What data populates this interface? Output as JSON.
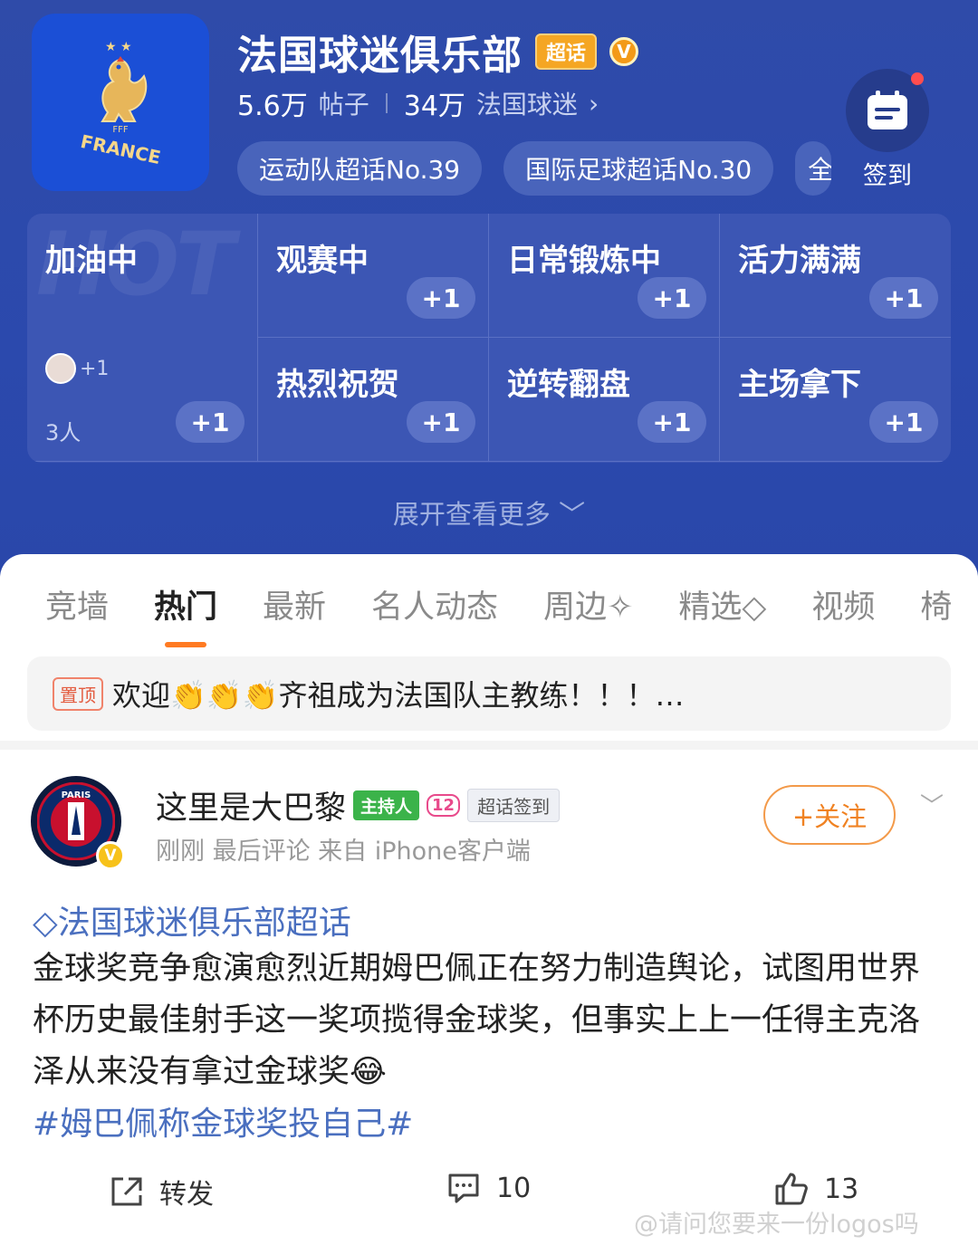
{
  "header": {
    "logo_text": "FRANCE",
    "title": "法国球迷俱乐部",
    "chaohua_badge": "超话",
    "verified_badge": "V",
    "posts_count": "5.6万",
    "posts_label": "帖子",
    "fans_count": "34万",
    "fans_label": "法国球迷",
    "tags": [
      "运动队超话No.39",
      "国际足球超话No.30",
      "全"
    ],
    "checkin_label": "签到",
    "expand_label": "展开查看更多"
  },
  "cheer_grid": {
    "watermark": "HOT",
    "big_cell": {
      "label": "加油中",
      "avatar_plus": "+1",
      "people": "3人",
      "plus": "+1"
    },
    "cells": [
      {
        "label": "观赛中",
        "plus": "+1"
      },
      {
        "label": "日常锻炼中",
        "plus": "+1"
      },
      {
        "label": "活力满满",
        "plus": "+1"
      },
      {
        "label": "热烈祝贺",
        "plus": "+1"
      },
      {
        "label": "逆转翻盘",
        "plus": "+1"
      },
      {
        "label": "主场拿下",
        "plus": "+1"
      }
    ]
  },
  "tabs": [
    "竞墙",
    "热门",
    "最新",
    "名人动态",
    "周边",
    "精选",
    "视频",
    "椅"
  ],
  "pinned": {
    "badge": "置顶",
    "text": "欢迎👏👏👏齐祖成为法国队主教练！！！…"
  },
  "post": {
    "username": "这里是大巴黎",
    "host_badge": "主持人",
    "level_badge": "12",
    "sign_badge": "超话签到",
    "meta": "刚刚  最后评论   来自 iPhone客户端",
    "follow_label": "+关注",
    "topic": "法国球迷俱乐部超话",
    "body": "金球奖竞争愈演愈烈近期姆巴佩正在努力制造舆论，试图用世界杯历史最佳射手这一奖项揽得金球奖，但事实上上一任得主克洛泽从来没有拿过金球奖😂",
    "hashtag": "#姆巴佩称金球奖投自己#",
    "repost_label": "转发",
    "comment_count": "10",
    "like_count": "13"
  },
  "watermark": "@请问您要来一份logos吗",
  "colors": {
    "header_bg": "#2b49ad",
    "accent_orange": "#f08222",
    "link_blue": "#4a6fbf"
  }
}
